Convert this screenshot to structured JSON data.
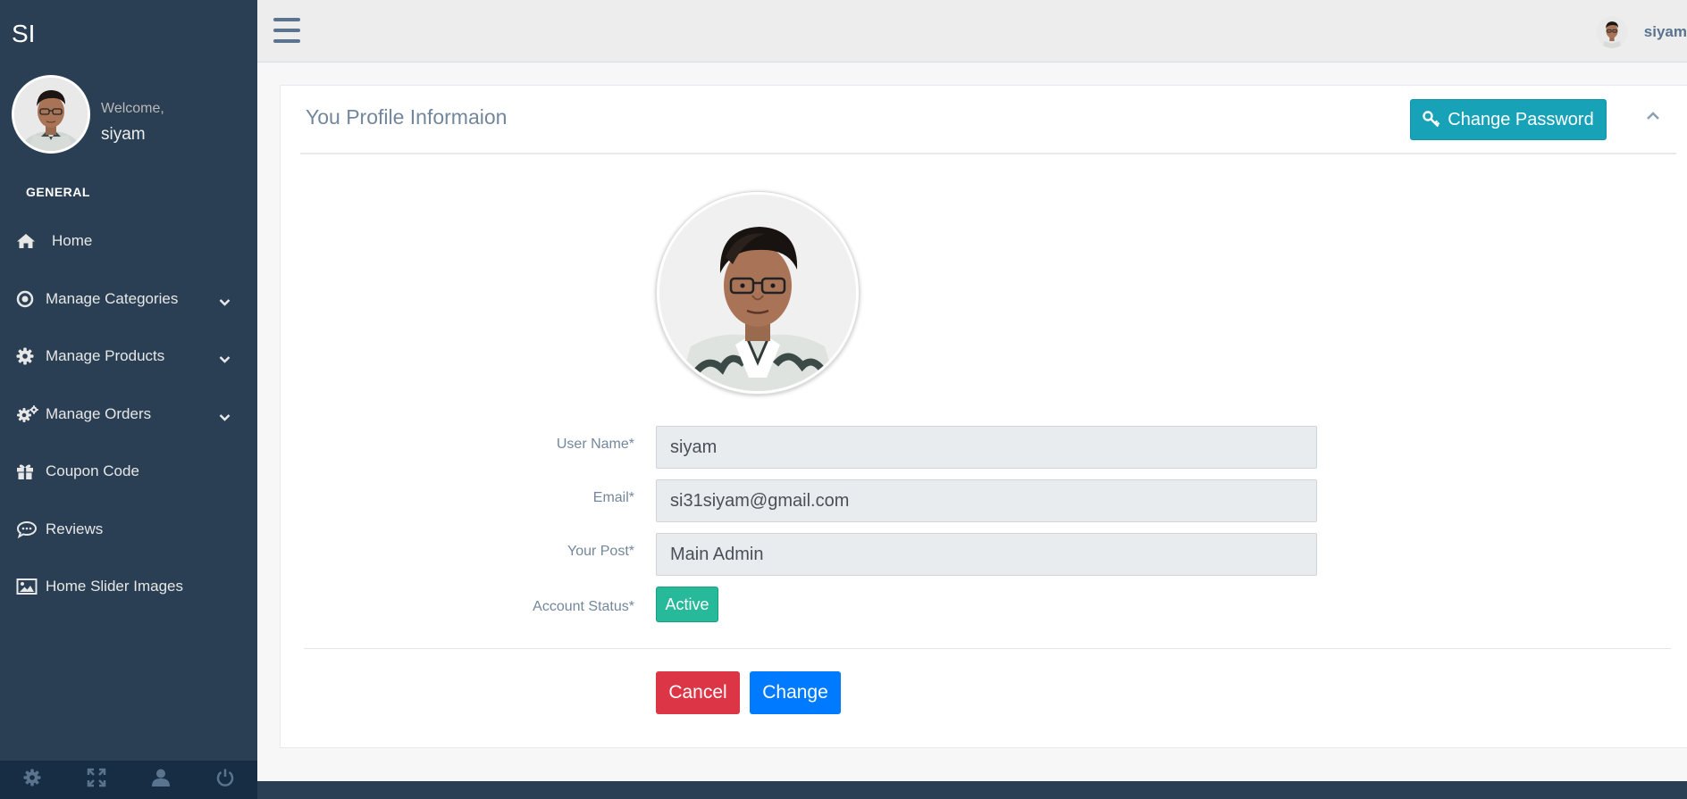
{
  "brand": "SI",
  "sidebar": {
    "welcome": "Welcome,",
    "username": "siyam",
    "section_title": "GENERAL",
    "items": [
      {
        "label": "Home",
        "icon": "home-icon",
        "has_caret": false
      },
      {
        "label": "Manage Categories",
        "icon": "dot-circle-icon",
        "has_caret": true
      },
      {
        "label": "Manage Products",
        "icon": "gear-icon",
        "has_caret": true
      },
      {
        "label": "Manage Orders",
        "icon": "gears-icon",
        "has_caret": true
      },
      {
        "label": "Coupon Code",
        "icon": "gift-icon",
        "has_caret": false
      },
      {
        "label": "Reviews",
        "icon": "comment-icon",
        "has_caret": false
      },
      {
        "label": "Home Slider Images",
        "icon": "image-icon",
        "has_caret": false
      }
    ],
    "footer_icons": [
      "settings-icon",
      "fullscreen-icon",
      "user-icon",
      "power-icon"
    ]
  },
  "topbar": {
    "username": "siyam"
  },
  "panel": {
    "title": "You Profile Informaion",
    "change_password_label": "Change Password",
    "fields": {
      "username_label": "User Name*",
      "username_value": "siyam",
      "email_label": "Email*",
      "email_value": "si31siyam@gmail.com",
      "post_label": "Your Post*",
      "post_value": "Main Admin",
      "status_label": "Account Status*",
      "status_value": "Active"
    },
    "cancel_label": "Cancel",
    "change_label": "Change"
  },
  "colors": {
    "sidebar_bg": "#2a3f54",
    "info": "#17a2b8",
    "success": "#26b99a",
    "danger": "#dc3545",
    "primary": "#007bff"
  }
}
